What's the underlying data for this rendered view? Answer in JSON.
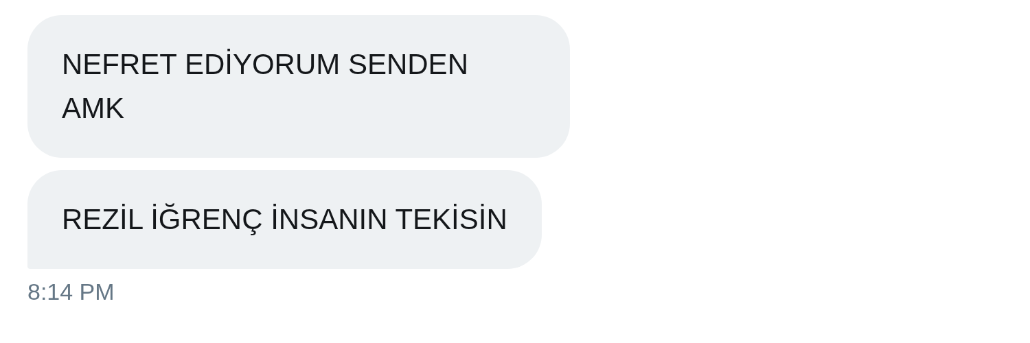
{
  "messages": [
    {
      "text": "NEFRET EDİYORUM SENDEN AMK",
      "tail": false
    },
    {
      "text": "REZİL İĞRENÇ İNSANIN TEKİSİN",
      "tail": true
    }
  ],
  "timestamp": "8:14 PM"
}
